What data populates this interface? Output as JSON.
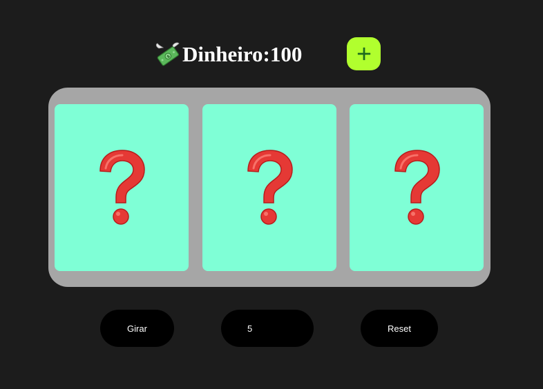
{
  "header": {
    "money_label": "Dinheiro:",
    "money_value": "100",
    "money_icon": "money-with-wings-icon",
    "add_icon": "plus-icon",
    "add_button_color": "#b1ff2e"
  },
  "machine": {
    "background": "#a6a6a6",
    "slot_color": "#7fffd6",
    "slots": [
      {
        "symbol": "question-mark-icon"
      },
      {
        "symbol": "question-mark-icon"
      },
      {
        "symbol": "question-mark-icon"
      }
    ]
  },
  "controls": {
    "spin_label": "Girar",
    "bet_value": "5",
    "reset_label": "Reset"
  }
}
